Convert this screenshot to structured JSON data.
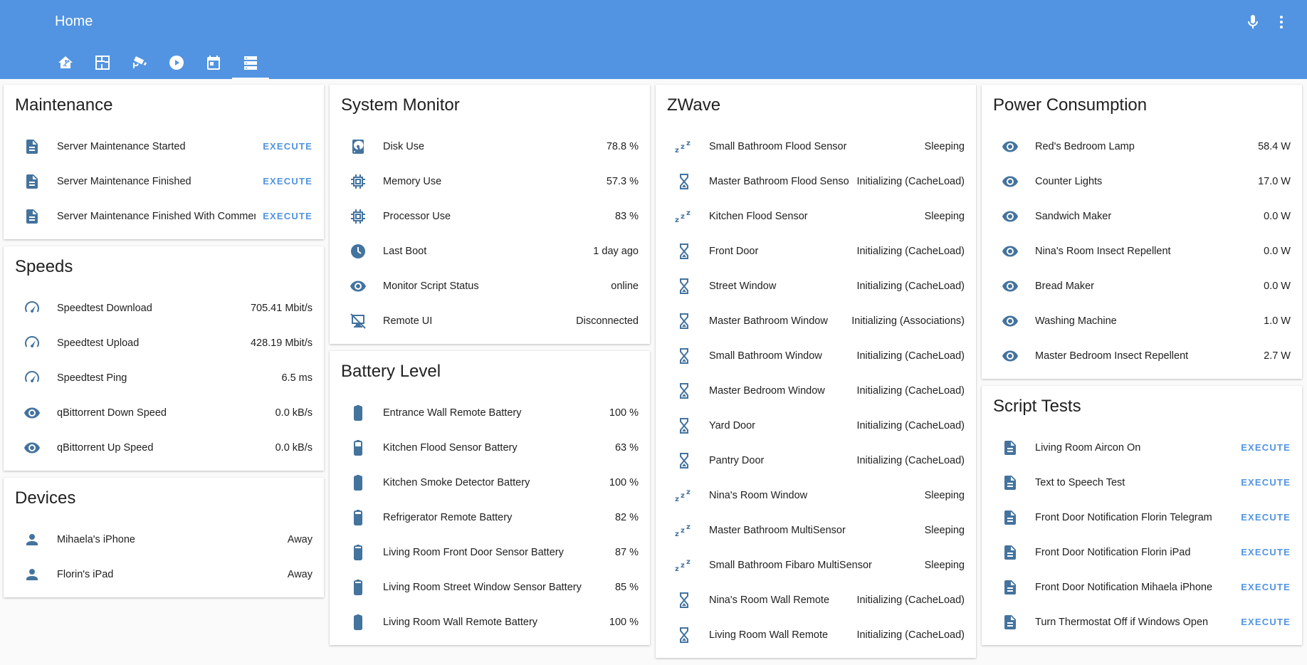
{
  "header": {
    "title": "Home"
  },
  "tabs": [
    {
      "icon": "home-assistant-icon"
    },
    {
      "icon": "floorplan-icon"
    },
    {
      "icon": "cctv-icon"
    },
    {
      "icon": "play-circle-icon"
    },
    {
      "icon": "calendar-icon"
    },
    {
      "icon": "server-icon",
      "active": true
    }
  ],
  "colors": {
    "header": "#5294e2",
    "icon": "#44739e",
    "accent": "#5294e2"
  },
  "maintenance": {
    "title": "Maintenance",
    "rows": [
      {
        "name": "Server Maintenance Started",
        "action": "EXECUTE"
      },
      {
        "name": "Server Maintenance Finished",
        "action": "EXECUTE"
      },
      {
        "name": "Server Maintenance Finished With Comments",
        "action": "EXECUTE"
      }
    ]
  },
  "speeds": {
    "title": "Speeds",
    "rows": [
      {
        "icon": "speedometer-icon",
        "name": "Speedtest Download",
        "value": "705.41 Mbit/s"
      },
      {
        "icon": "speedometer-icon",
        "name": "Speedtest Upload",
        "value": "428.19 Mbit/s"
      },
      {
        "icon": "speedometer-icon",
        "name": "Speedtest Ping",
        "value": "6.5 ms"
      },
      {
        "icon": "eye-icon",
        "name": "qBittorrent Down Speed",
        "value": "0.0 kB/s"
      },
      {
        "icon": "eye-icon",
        "name": "qBittorrent Up Speed",
        "value": "0.0 kB/s"
      }
    ]
  },
  "devices": {
    "title": "Devices",
    "rows": [
      {
        "name": "Mihaela's iPhone",
        "value": "Away"
      },
      {
        "name": "Florin's iPad",
        "value": "Away"
      }
    ]
  },
  "system": {
    "title": "System Monitor",
    "rows": [
      {
        "icon": "harddisk-icon",
        "name": "Disk Use",
        "value": "78.8 %"
      },
      {
        "icon": "chip-icon",
        "name": "Memory Use",
        "value": "57.3 %"
      },
      {
        "icon": "chip-icon",
        "name": "Processor Use",
        "value": "83 %"
      },
      {
        "icon": "clock-icon",
        "name": "Last Boot",
        "value": "1 day ago"
      },
      {
        "icon": "eye-icon",
        "name": "Monitor Script Status",
        "value": "online"
      },
      {
        "icon": "remote-desktop-icon",
        "name": "Remote UI",
        "value": "Disconnected"
      }
    ]
  },
  "battery": {
    "title": "Battery Level",
    "rows": [
      {
        "name": "Entrance Wall Remote Battery",
        "value": "100 %",
        "level": 1.0
      },
      {
        "name": "Kitchen Flood Sensor Battery",
        "value": "63 %",
        "level": 0.63
      },
      {
        "name": "Kitchen Smoke Detector Battery",
        "value": "100 %",
        "level": 1.0
      },
      {
        "name": "Refrigerator Remote Battery",
        "value": "82 %",
        "level": 0.82
      },
      {
        "name": "Living Room Front Door Sensor Battery",
        "value": "87 %",
        "level": 0.87
      },
      {
        "name": "Living Room Street Window Sensor Battery",
        "value": "85 %",
        "level": 0.85
      },
      {
        "name": "Living Room Wall Remote Battery",
        "value": "100 %",
        "level": 1.0
      }
    ]
  },
  "zwave": {
    "title": "ZWave",
    "rows": [
      {
        "icon": "sleep-icon",
        "name": "Small Bathroom Flood Sensor",
        "value": "Sleeping"
      },
      {
        "icon": "hourglass-icon",
        "name": "Master Bathroom Flood Sensor",
        "value": "Initializing (CacheLoad)"
      },
      {
        "icon": "sleep-icon",
        "name": "Kitchen Flood Sensor",
        "value": "Sleeping"
      },
      {
        "icon": "hourglass-icon",
        "name": "Front Door",
        "value": "Initializing (CacheLoad)"
      },
      {
        "icon": "hourglass-icon",
        "name": "Street Window",
        "value": "Initializing (CacheLoad)"
      },
      {
        "icon": "hourglass-icon",
        "name": "Master Bathroom Window",
        "value": "Initializing (Associations)"
      },
      {
        "icon": "hourglass-icon",
        "name": "Small Bathroom Window",
        "value": "Initializing (CacheLoad)"
      },
      {
        "icon": "hourglass-icon",
        "name": "Master Bedroom Window",
        "value": "Initializing (CacheLoad)"
      },
      {
        "icon": "hourglass-icon",
        "name": "Yard Door",
        "value": "Initializing (CacheLoad)"
      },
      {
        "icon": "hourglass-icon",
        "name": "Pantry Door",
        "value": "Initializing (CacheLoad)"
      },
      {
        "icon": "sleep-icon",
        "name": "Nina's Room Window",
        "value": "Sleeping"
      },
      {
        "icon": "sleep-icon",
        "name": "Master Bathroom MultiSensor",
        "value": "Sleeping"
      },
      {
        "icon": "sleep-icon",
        "name": "Small Bathroom Fibaro MultiSensor",
        "value": "Sleeping"
      },
      {
        "icon": "hourglass-icon",
        "name": "Nina's Room Wall Remote",
        "value": "Initializing (CacheLoad)"
      },
      {
        "icon": "hourglass-icon",
        "name": "Living Room Wall Remote",
        "value": "Initializing (CacheLoad)"
      }
    ]
  },
  "power": {
    "title": "Power Consumption",
    "rows": [
      {
        "name": "Red's Bedroom Lamp",
        "value": "58.4 W"
      },
      {
        "name": "Counter Lights",
        "value": "17.0 W"
      },
      {
        "name": "Sandwich Maker",
        "value": "0.0 W"
      },
      {
        "name": "Nina's Room Insect Repellent",
        "value": "0.0 W"
      },
      {
        "name": "Bread Maker",
        "value": "0.0 W"
      },
      {
        "name": "Washing Machine",
        "value": "1.0 W"
      },
      {
        "name": "Master Bedroom Insect Repellent",
        "value": "2.7 W"
      }
    ]
  },
  "scripts": {
    "title": "Script Tests",
    "rows": [
      {
        "name": "Living Room Aircon On",
        "action": "EXECUTE"
      },
      {
        "name": "Text to Speech Test",
        "action": "EXECUTE"
      },
      {
        "name": "Front Door Notification Florin Telegram",
        "action": "EXECUTE"
      },
      {
        "name": "Front Door Notification Florin iPad",
        "action": "EXECUTE"
      },
      {
        "name": "Front Door Notification Mihaela iPhone",
        "action": "EXECUTE"
      },
      {
        "name": "Turn Thermostat Off if Windows Open",
        "action": "EXECUTE"
      }
    ]
  }
}
